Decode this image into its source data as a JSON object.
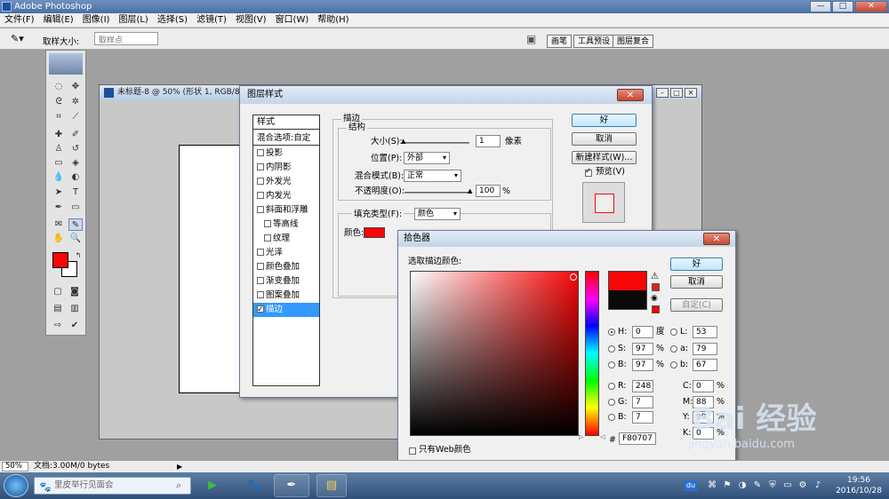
{
  "app": {
    "title": "Adobe Photoshop",
    "window_buttons": {
      "minimize": "—",
      "maximize": "□",
      "close": "✕"
    }
  },
  "menubar": [
    "文件(F)",
    "编辑(E)",
    "图像(I)",
    "图层(L)",
    "选择(S)",
    "滤镜(T)",
    "视图(V)",
    "窗口(W)",
    "帮助(H)"
  ],
  "optionsbar": {
    "sample_size_label": "取样大小:",
    "sample_size_value": "取样点",
    "palette_tabs": [
      "画笔",
      "工具预设",
      "图层复合"
    ]
  },
  "document": {
    "title": "未标题-8 @ 50% (形状 1, RGB/8)"
  },
  "layer_style": {
    "title": "图层样式",
    "list": [
      {
        "label": "样式",
        "checkbox": false,
        "selected": false,
        "header": true
      },
      {
        "label": "混合选项:自定",
        "checkbox": false,
        "selected": false,
        "header": true
      },
      {
        "label": "投影",
        "checkbox": true,
        "checked": false
      },
      {
        "label": "内阴影",
        "checkbox": true,
        "checked": false
      },
      {
        "label": "外发光",
        "checkbox": true,
        "checked": false
      },
      {
        "label": "内发光",
        "checkbox": true,
        "checked": false
      },
      {
        "label": "斜面和浮雕",
        "checkbox": true,
        "checked": false
      },
      {
        "label": "等高线",
        "checkbox": true,
        "checked": false,
        "indent": true
      },
      {
        "label": "纹理",
        "checkbox": true,
        "checked": false,
        "indent": true
      },
      {
        "label": "光泽",
        "checkbox": true,
        "checked": false
      },
      {
        "label": "颜色叠加",
        "checkbox": true,
        "checked": false
      },
      {
        "label": "渐变叠加",
        "checkbox": true,
        "checked": false
      },
      {
        "label": "图案叠加",
        "checkbox": true,
        "checked": false
      },
      {
        "label": "描边",
        "checkbox": true,
        "checked": true,
        "selected": true
      }
    ],
    "stroke_group": "描边",
    "structure_group": "结构",
    "size_label": "大小(S):",
    "size_value": "1",
    "size_unit": "像素",
    "position_label": "位置(P):",
    "position_value": "外部",
    "blend_label": "混合模式(B):",
    "blend_value": "正常",
    "opacity_label": "不透明度(O):",
    "opacity_value": "100",
    "opacity_unit": "%",
    "fill_type_label": "填充类型(F):",
    "fill_type_value": "颜色",
    "color_label": "颜色:",
    "stroke_color": "#f80707",
    "ok": "好",
    "cancel": "取消",
    "new_style": "新建样式(W)...",
    "preview_label": "预览(V)",
    "preview_checked": true
  },
  "color_picker": {
    "title": "拾色器",
    "prompt": "选取描边颜色:",
    "ok": "好",
    "cancel": "取消",
    "custom": "自定(C)",
    "hsb": {
      "h_label": "H:",
      "h": "0",
      "h_unit": "度",
      "s_label": "S:",
      "s": "97",
      "s_unit": "%",
      "b_label": "B:",
      "b": "97",
      "b_unit": "%"
    },
    "rgb": {
      "r_label": "R:",
      "r": "248",
      "g_label": "G:",
      "g": "7",
      "b_label": "B:",
      "b": "7"
    },
    "lab": {
      "l_label": "L:",
      "l": "53",
      "a_label": "a:",
      "a": "79",
      "b_label": "b:",
      "b": "67"
    },
    "cmyk": {
      "c_label": "C:",
      "c": "0",
      "m_label": "M:",
      "m": "88",
      "y_label": "Y:",
      "y": "99",
      "k_label": "K:",
      "k": "0",
      "unit": "%"
    },
    "hex_label": "#",
    "hex": "F80707",
    "web_only_label": "只有Web颜色",
    "new_color": "#f80707",
    "old_color": "#0a0a0a"
  },
  "statusbar": {
    "zoom": "50%",
    "doc_info": "文档:3.00M/0 bytes"
  },
  "taskbar": {
    "search_placeholder": "里皮举行见面会",
    "time": "19:56",
    "date": "2016/10/28"
  },
  "watermark": {
    "text": "Bai 经验",
    "url": "jingyan.baidu.com"
  },
  "colors": {
    "foreground": "#f80707",
    "background": "#ffffff",
    "selection": "#3399ff"
  }
}
